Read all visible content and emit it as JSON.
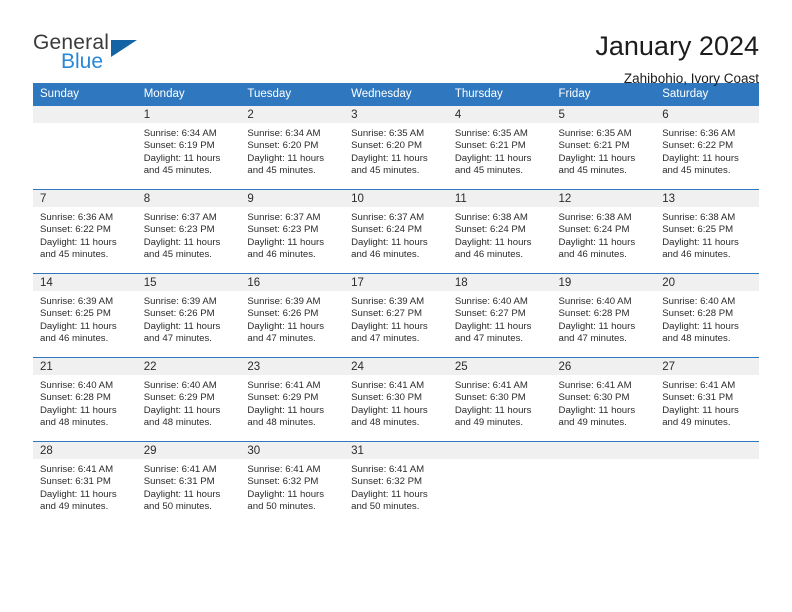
{
  "brand": {
    "name_part1": "General",
    "name_part2": "Blue",
    "accent_color": "#2787d8",
    "triangle_color": "#1464a5"
  },
  "header": {
    "title": "January 2024",
    "subtitle": "Zahibohio, Ivory Coast"
  },
  "calendar": {
    "header_bg": "#2f78bf",
    "daynum_bg": "#f0f0f0",
    "weekday_headers": [
      "Sunday",
      "Monday",
      "Tuesday",
      "Wednesday",
      "Thursday",
      "Friday",
      "Saturday"
    ],
    "weeks": [
      [
        {
          "day": "",
          "sunrise": "",
          "sunset": "",
          "daylight_line1": "",
          "daylight_line2": ""
        },
        {
          "day": "1",
          "sunrise": "Sunrise: 6:34 AM",
          "sunset": "Sunset: 6:19 PM",
          "daylight_line1": "Daylight: 11 hours",
          "daylight_line2": "and 45 minutes."
        },
        {
          "day": "2",
          "sunrise": "Sunrise: 6:34 AM",
          "sunset": "Sunset: 6:20 PM",
          "daylight_line1": "Daylight: 11 hours",
          "daylight_line2": "and 45 minutes."
        },
        {
          "day": "3",
          "sunrise": "Sunrise: 6:35 AM",
          "sunset": "Sunset: 6:20 PM",
          "daylight_line1": "Daylight: 11 hours",
          "daylight_line2": "and 45 minutes."
        },
        {
          "day": "4",
          "sunrise": "Sunrise: 6:35 AM",
          "sunset": "Sunset: 6:21 PM",
          "daylight_line1": "Daylight: 11 hours",
          "daylight_line2": "and 45 minutes."
        },
        {
          "day": "5",
          "sunrise": "Sunrise: 6:35 AM",
          "sunset": "Sunset: 6:21 PM",
          "daylight_line1": "Daylight: 11 hours",
          "daylight_line2": "and 45 minutes."
        },
        {
          "day": "6",
          "sunrise": "Sunrise: 6:36 AM",
          "sunset": "Sunset: 6:22 PM",
          "daylight_line1": "Daylight: 11 hours",
          "daylight_line2": "and 45 minutes."
        }
      ],
      [
        {
          "day": "7",
          "sunrise": "Sunrise: 6:36 AM",
          "sunset": "Sunset: 6:22 PM",
          "daylight_line1": "Daylight: 11 hours",
          "daylight_line2": "and 45 minutes."
        },
        {
          "day": "8",
          "sunrise": "Sunrise: 6:37 AM",
          "sunset": "Sunset: 6:23 PM",
          "daylight_line1": "Daylight: 11 hours",
          "daylight_line2": "and 45 minutes."
        },
        {
          "day": "9",
          "sunrise": "Sunrise: 6:37 AM",
          "sunset": "Sunset: 6:23 PM",
          "daylight_line1": "Daylight: 11 hours",
          "daylight_line2": "and 46 minutes."
        },
        {
          "day": "10",
          "sunrise": "Sunrise: 6:37 AM",
          "sunset": "Sunset: 6:24 PM",
          "daylight_line1": "Daylight: 11 hours",
          "daylight_line2": "and 46 minutes."
        },
        {
          "day": "11",
          "sunrise": "Sunrise: 6:38 AM",
          "sunset": "Sunset: 6:24 PM",
          "daylight_line1": "Daylight: 11 hours",
          "daylight_line2": "and 46 minutes."
        },
        {
          "day": "12",
          "sunrise": "Sunrise: 6:38 AM",
          "sunset": "Sunset: 6:24 PM",
          "daylight_line1": "Daylight: 11 hours",
          "daylight_line2": "and 46 minutes."
        },
        {
          "day": "13",
          "sunrise": "Sunrise: 6:38 AM",
          "sunset": "Sunset: 6:25 PM",
          "daylight_line1": "Daylight: 11 hours",
          "daylight_line2": "and 46 minutes."
        }
      ],
      [
        {
          "day": "14",
          "sunrise": "Sunrise: 6:39 AM",
          "sunset": "Sunset: 6:25 PM",
          "daylight_line1": "Daylight: 11 hours",
          "daylight_line2": "and 46 minutes."
        },
        {
          "day": "15",
          "sunrise": "Sunrise: 6:39 AM",
          "sunset": "Sunset: 6:26 PM",
          "daylight_line1": "Daylight: 11 hours",
          "daylight_line2": "and 47 minutes."
        },
        {
          "day": "16",
          "sunrise": "Sunrise: 6:39 AM",
          "sunset": "Sunset: 6:26 PM",
          "daylight_line1": "Daylight: 11 hours",
          "daylight_line2": "and 47 minutes."
        },
        {
          "day": "17",
          "sunrise": "Sunrise: 6:39 AM",
          "sunset": "Sunset: 6:27 PM",
          "daylight_line1": "Daylight: 11 hours",
          "daylight_line2": "and 47 minutes."
        },
        {
          "day": "18",
          "sunrise": "Sunrise: 6:40 AM",
          "sunset": "Sunset: 6:27 PM",
          "daylight_line1": "Daylight: 11 hours",
          "daylight_line2": "and 47 minutes."
        },
        {
          "day": "19",
          "sunrise": "Sunrise: 6:40 AM",
          "sunset": "Sunset: 6:28 PM",
          "daylight_line1": "Daylight: 11 hours",
          "daylight_line2": "and 47 minutes."
        },
        {
          "day": "20",
          "sunrise": "Sunrise: 6:40 AM",
          "sunset": "Sunset: 6:28 PM",
          "daylight_line1": "Daylight: 11 hours",
          "daylight_line2": "and 48 minutes."
        }
      ],
      [
        {
          "day": "21",
          "sunrise": "Sunrise: 6:40 AM",
          "sunset": "Sunset: 6:28 PM",
          "daylight_line1": "Daylight: 11 hours",
          "daylight_line2": "and 48 minutes."
        },
        {
          "day": "22",
          "sunrise": "Sunrise: 6:40 AM",
          "sunset": "Sunset: 6:29 PM",
          "daylight_line1": "Daylight: 11 hours",
          "daylight_line2": "and 48 minutes."
        },
        {
          "day": "23",
          "sunrise": "Sunrise: 6:41 AM",
          "sunset": "Sunset: 6:29 PM",
          "daylight_line1": "Daylight: 11 hours",
          "daylight_line2": "and 48 minutes."
        },
        {
          "day": "24",
          "sunrise": "Sunrise: 6:41 AM",
          "sunset": "Sunset: 6:30 PM",
          "daylight_line1": "Daylight: 11 hours",
          "daylight_line2": "and 48 minutes."
        },
        {
          "day": "25",
          "sunrise": "Sunrise: 6:41 AM",
          "sunset": "Sunset: 6:30 PM",
          "daylight_line1": "Daylight: 11 hours",
          "daylight_line2": "and 49 minutes."
        },
        {
          "day": "26",
          "sunrise": "Sunrise: 6:41 AM",
          "sunset": "Sunset: 6:30 PM",
          "daylight_line1": "Daylight: 11 hours",
          "daylight_line2": "and 49 minutes."
        },
        {
          "day": "27",
          "sunrise": "Sunrise: 6:41 AM",
          "sunset": "Sunset: 6:31 PM",
          "daylight_line1": "Daylight: 11 hours",
          "daylight_line2": "and 49 minutes."
        }
      ],
      [
        {
          "day": "28",
          "sunrise": "Sunrise: 6:41 AM",
          "sunset": "Sunset: 6:31 PM",
          "daylight_line1": "Daylight: 11 hours",
          "daylight_line2": "and 49 minutes."
        },
        {
          "day": "29",
          "sunrise": "Sunrise: 6:41 AM",
          "sunset": "Sunset: 6:31 PM",
          "daylight_line1": "Daylight: 11 hours",
          "daylight_line2": "and 50 minutes."
        },
        {
          "day": "30",
          "sunrise": "Sunrise: 6:41 AM",
          "sunset": "Sunset: 6:32 PM",
          "daylight_line1": "Daylight: 11 hours",
          "daylight_line2": "and 50 minutes."
        },
        {
          "day": "31",
          "sunrise": "Sunrise: 6:41 AM",
          "sunset": "Sunset: 6:32 PM",
          "daylight_line1": "Daylight: 11 hours",
          "daylight_line2": "and 50 minutes."
        },
        {
          "day": "",
          "sunrise": "",
          "sunset": "",
          "daylight_line1": "",
          "daylight_line2": ""
        },
        {
          "day": "",
          "sunrise": "",
          "sunset": "",
          "daylight_line1": "",
          "daylight_line2": ""
        },
        {
          "day": "",
          "sunrise": "",
          "sunset": "",
          "daylight_line1": "",
          "daylight_line2": ""
        }
      ]
    ]
  }
}
